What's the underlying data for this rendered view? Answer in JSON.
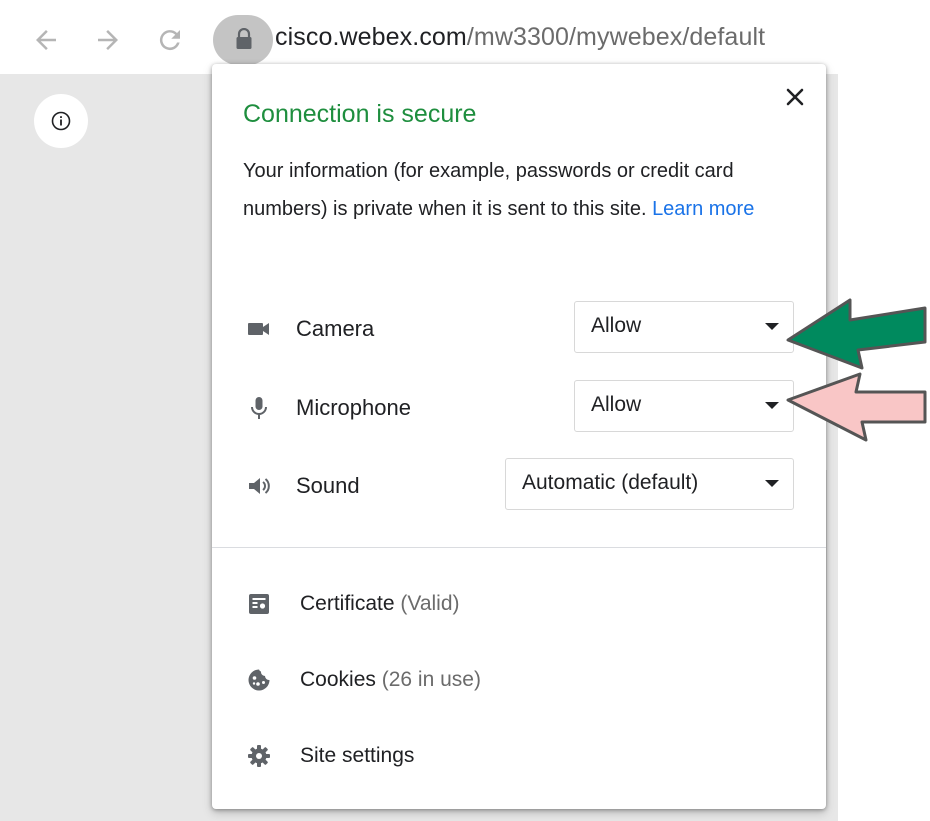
{
  "browser": {
    "url_host": "cisco.webex.com",
    "url_path": "/mw3300/mywebex/default"
  },
  "popup": {
    "title": "Connection is secure",
    "description": "Your information (for example, passwords or credit card numbers) is private when it is sent to this site.",
    "learn_more": "Learn more",
    "permissions": [
      {
        "icon": "camera-icon",
        "label": "Camera",
        "value": "Allow"
      },
      {
        "icon": "microphone-icon",
        "label": "Microphone",
        "value": "Allow"
      },
      {
        "icon": "speaker-icon",
        "label": "Sound",
        "value": "Automatic (default)"
      }
    ],
    "links": [
      {
        "icon": "certificate-icon",
        "label": "Certificate",
        "sub": "(Valid)"
      },
      {
        "icon": "cookie-icon",
        "label": "Cookies",
        "sub": "(26 in use)"
      },
      {
        "icon": "gear-icon",
        "label": "Site settings",
        "sub": ""
      }
    ]
  },
  "annotations": {
    "camera_arrow_color": "#008a5e",
    "microphone_arrow_color": "#f9c6c6",
    "arrow_outline_color": "#555555"
  },
  "colors": {
    "secure_green": "#1e8e3e",
    "link_blue": "#1a73e8"
  }
}
